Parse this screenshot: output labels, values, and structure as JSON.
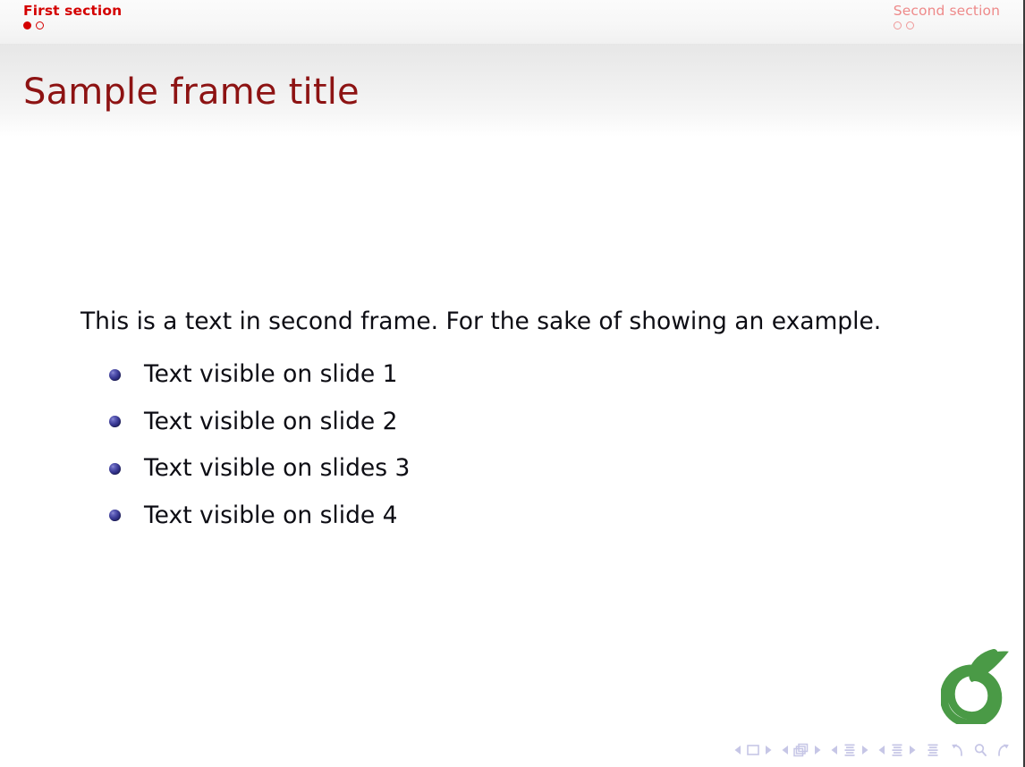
{
  "header": {
    "left_section": {
      "label": "First section",
      "state": "active",
      "dots": [
        "filled",
        "hollow"
      ]
    },
    "right_section": {
      "label": "Second section",
      "state": "inactive",
      "dots": [
        "hollow",
        "hollow"
      ]
    }
  },
  "title": {
    "text": "Sample frame title"
  },
  "content": {
    "paragraph": "This is a text in second frame.  For the sake of showing an example.",
    "bullets": [
      {
        "text": "Text visible on slide 1",
        "marker": "ball-bullet"
      },
      {
        "text": "Text visible on slide 2",
        "marker": "ball-bullet"
      },
      {
        "text": "Text visible on slides 3",
        "marker": "ball-bullet"
      },
      {
        "text": "Text visible on slide 4",
        "marker": "ball-bullet"
      }
    ]
  },
  "logo": {
    "name": "overleaf-logo",
    "color": "#4a9a46"
  },
  "nav_symbols": {
    "color": "#c6c6e6",
    "items": [
      {
        "name": "slide-prev-icon",
        "glyph": "left-triangle"
      },
      {
        "name": "slide-icon",
        "glyph": "square"
      },
      {
        "name": "slide-next-icon",
        "glyph": "right-triangle"
      },
      {
        "name": "frame-prev-icon",
        "glyph": "left-triangle"
      },
      {
        "name": "frame-icon",
        "glyph": "stacked-squares"
      },
      {
        "name": "frame-next-icon",
        "glyph": "right-triangle"
      },
      {
        "name": "subsection-prev-icon",
        "glyph": "left-triangle"
      },
      {
        "name": "subsection-icon",
        "glyph": "lines-small"
      },
      {
        "name": "subsection-next-icon",
        "glyph": "right-triangle"
      },
      {
        "name": "section-prev-icon",
        "glyph": "left-triangle"
      },
      {
        "name": "section-icon",
        "glyph": "lines-small"
      },
      {
        "name": "section-next-icon",
        "glyph": "right-triangle"
      },
      {
        "name": "presentation-icon",
        "glyph": "lines-large"
      },
      {
        "name": "back-icon",
        "glyph": "curved-arrow-left"
      },
      {
        "name": "search-icon",
        "glyph": "magnifier"
      },
      {
        "name": "forward-icon",
        "glyph": "curved-arrow-right"
      }
    ]
  },
  "colors": {
    "section_active": "#d40000",
    "section_inactive": "#ee8a8a",
    "frame_title": "#8d1313",
    "body_text": "#0d0d14",
    "bullet": "#2b2b82",
    "logo_green": "#4a9a46",
    "nav_symbol": "#c6c6e6"
  }
}
